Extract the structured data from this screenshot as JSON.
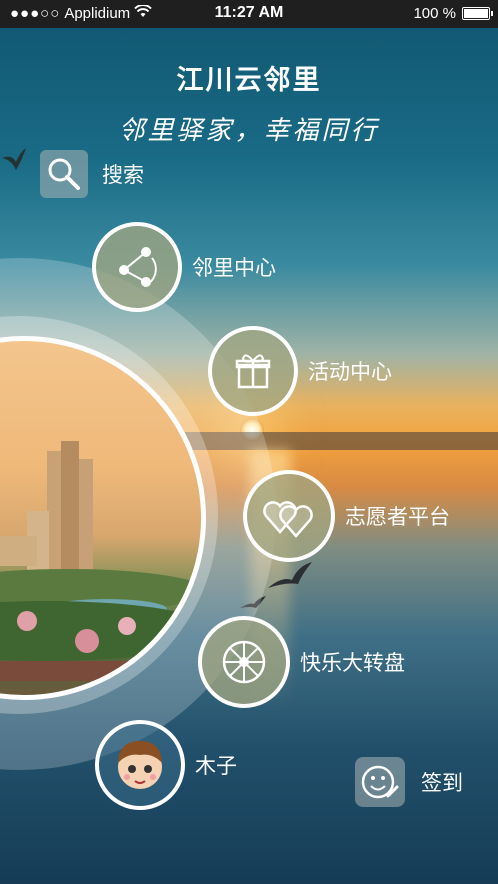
{
  "status_bar": {
    "carrier": "Applidium",
    "signal_dots": "●●●○○",
    "time": "11:27 AM",
    "battery": "100 %"
  },
  "header": {
    "title": "江川云邻里",
    "slogan": "邻里驿家，幸福同行"
  },
  "search": {
    "label": "搜索",
    "icon": "search-icon"
  },
  "menu": [
    {
      "label": "邻里中心",
      "icon": "share-nodes-icon"
    },
    {
      "label": "活动中心",
      "icon": "gift-icon"
    },
    {
      "label": "志愿者平台",
      "icon": "hearts-icon"
    },
    {
      "label": "快乐大转盘",
      "icon": "wheel-icon"
    },
    {
      "label": "木子",
      "icon": "avatar"
    }
  ],
  "signin": {
    "label": "签到",
    "icon": "smiley-pen-icon"
  }
}
